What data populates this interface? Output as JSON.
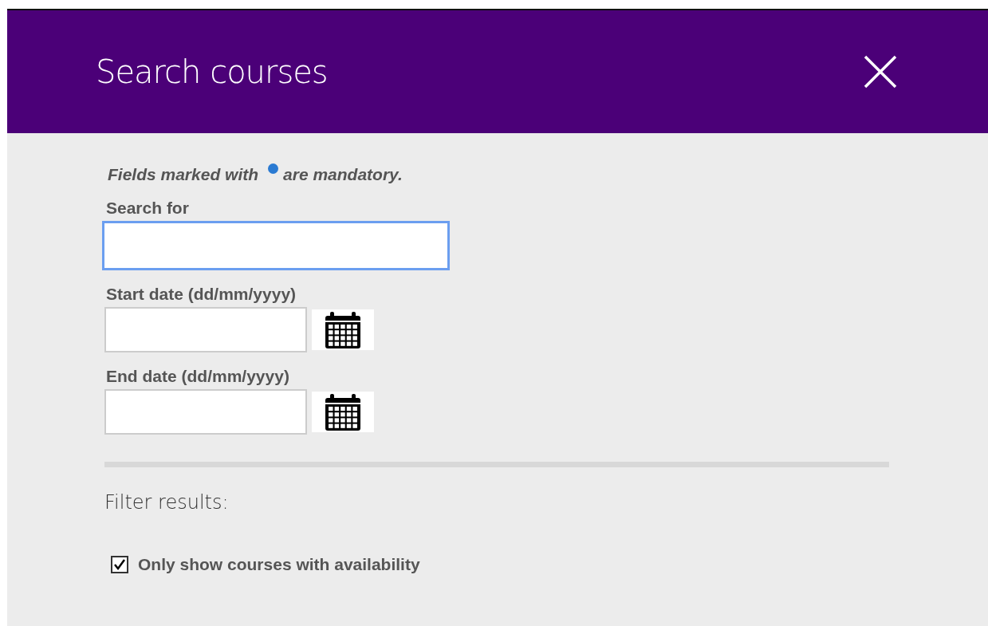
{
  "dialog": {
    "title": "Search courses"
  },
  "mandatory_note": {
    "before": "Fields marked with",
    "after": "are mandatory."
  },
  "fields": [
    {
      "kind": "text",
      "label": "Search for",
      "focused": true
    },
    {
      "kind": "date",
      "label": "Start date (dd/mm/yyyy)",
      "focused": false
    },
    {
      "kind": "date",
      "label": "End date (dd/mm/yyyy)",
      "focused": false
    }
  ],
  "filter": {
    "heading": "Filter results:",
    "options": [
      {
        "label": "Only show courses with availability",
        "checked": true
      }
    ]
  }
}
